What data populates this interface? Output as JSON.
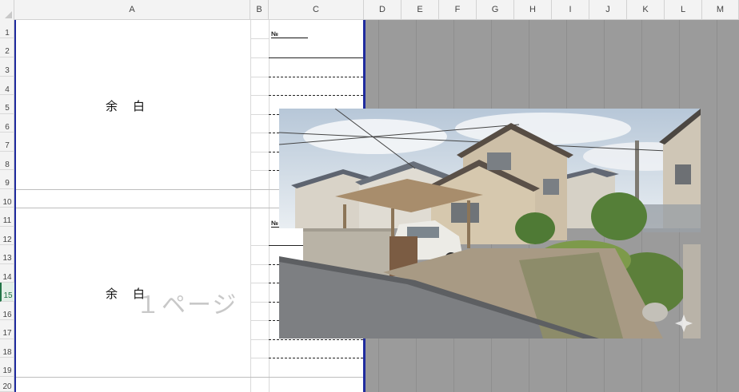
{
  "columns": [
    "A",
    "B",
    "C",
    "D",
    "E",
    "F",
    "G",
    "H",
    "I",
    "J",
    "K",
    "L",
    "M"
  ],
  "rows": [
    "1",
    "2",
    "3",
    "4",
    "5",
    "6",
    "7",
    "8",
    "9",
    "10",
    "11",
    "12",
    "13",
    "14",
    "15",
    "16",
    "17",
    "18",
    "19",
    "20"
  ],
  "selected_row": "15",
  "blocks": [
    {
      "label": "余　白",
      "no_label": "№"
    },
    {
      "label": "余　白",
      "no_label": "№"
    }
  ],
  "watermark": "１ページ",
  "image": {
    "subject": "house-photo",
    "description_icon": "sparkle-icon"
  }
}
